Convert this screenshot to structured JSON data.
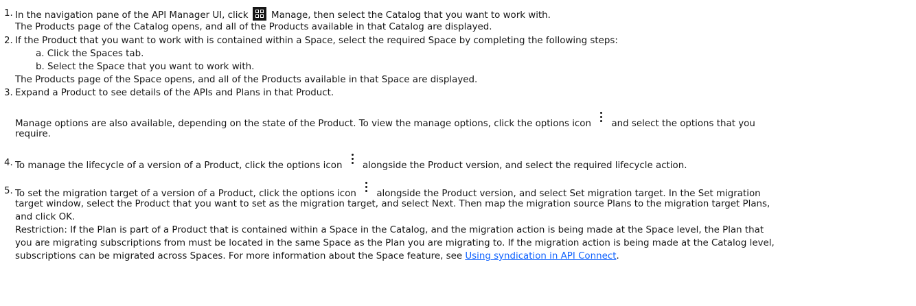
{
  "steps": {
    "s1": {
      "num": "1.",
      "pre": "In the navigation pane of the API Manager UI, click ",
      "icon": "manage-grid-icon",
      "post": " Manage, then select the Catalog that you want to work with.",
      "result": "The Products page of the Catalog opens, and all of the Products available in that Catalog are displayed."
    },
    "s2": {
      "num": "2.",
      "text": "If the Product that you want to work with is contained within a Space, select the required Space by completing the following steps:",
      "sub_a": "a. Click the Spaces tab.",
      "sub_b": "b. Select the Space that you want to work with.",
      "result": "The Products page of the Space opens, and all of the Products available in that Space are displayed."
    },
    "s3": {
      "num": "3.",
      "text": "Expand a Product to see details of the APIs and Plans in that Product.",
      "note_pre": "Manage options are also available, depending on the state of the Product. To view the manage options, click the options icon ",
      "icon": "options-kebab-icon",
      "note_post": " and select the options that you",
      "note_cont": "require."
    },
    "s4": {
      "num": "4.",
      "pre": "To manage the lifecycle of a version of a Product, click the options icon ",
      "icon": "options-kebab-icon",
      "post": " alongside the Product version, and select the required lifecycle action."
    },
    "s5": {
      "num": "5.",
      "pre": "To set the migration target of a version of a Product, click the options icon ",
      "icon": "options-kebab-icon",
      "post": " alongside the Product version, and select Set migration target. In the Set migration",
      "line2": "target window, select the Product that you want to set as the migration target, and select Next. Then map the migration source Plans to the migration target Plans,",
      "line3": "and click OK.",
      "restriction1": "Restriction: If the Plan is part of a Product that is contained within a Space in the Catalog, and the migration action is being made at the Space level, the Plan that",
      "restriction2": "you are migrating subscriptions from must be located in the same Space as the Plan you are migrating to. If the migration action is being made at the Catalog level,",
      "restriction3_pre": "subscriptions can be migrated across Spaces. For more information about the Space feature, see ",
      "link": "Using syndication in API Connect",
      "restriction3_post": "."
    }
  }
}
